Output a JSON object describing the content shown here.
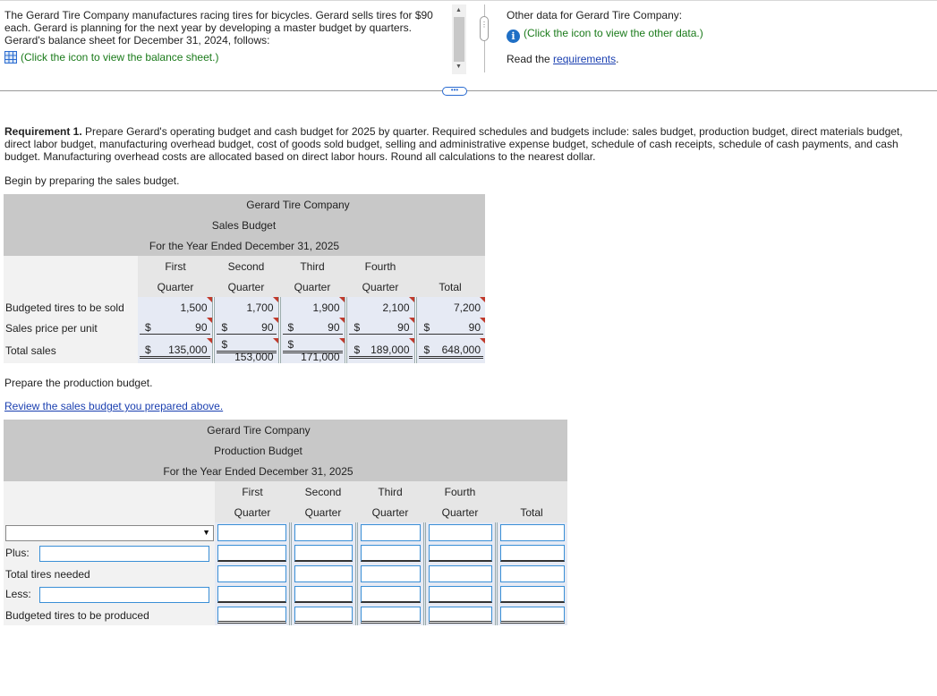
{
  "intro": {
    "text": "The Gerard Tire Company manufactures racing tires for bicycles. Gerard sells tires for $90 each. Gerard is planning for the next year by developing a master budget by quarters. Gerard's balance sheet for December 31, 2024, follows:",
    "balance_link": "(Click the icon to view the balance sheet.)"
  },
  "right": {
    "other_data": "Other data for Gerard Tire Company:",
    "other_link": "(Click the icon to view the other data.)",
    "read_prefix": "Read the",
    "req_link": "requirements",
    "read_suffix": "."
  },
  "requirement": {
    "bold": "Requirement 1.",
    "text": " Prepare Gerard's operating budget and cash budget for 2025 by quarter. Required schedules and budgets include: sales budget, production budget, direct materials budget, direct labor budget, manufacturing overhead budget, cost of goods sold budget, selling and administrative expense budget, schedule of cash receipts, schedule of cash payments, and cash budget. Manufacturing overhead costs are allocated based on direct labor hours. Round all calculations to the nearest dollar."
  },
  "begin_text": "Begin by preparing the sales budget.",
  "sales": {
    "company": "Gerard Tire Company",
    "title": "Sales Budget",
    "period": "For the Year Ended December 31, 2025",
    "col_top": [
      "First",
      "Second",
      "Third",
      "Fourth",
      ""
    ],
    "col_bottom": [
      "Quarter",
      "Quarter",
      "Quarter",
      "Quarter",
      "Total"
    ],
    "rows": [
      {
        "label": "Budgeted tires to be sold",
        "dollar": false,
        "values": [
          "1,500",
          "1,700",
          "1,900",
          "2,100",
          "7,200"
        ]
      },
      {
        "label": "Sales price per unit",
        "dollar": true,
        "values": [
          "90",
          "90",
          "90",
          "90",
          "90"
        ]
      },
      {
        "label": "Total sales",
        "dollar": true,
        "values": [
          "135,000",
          "153,000",
          "171,000",
          "189,000",
          "648,000"
        ]
      }
    ],
    "currency": "$"
  },
  "prep_prod": "Prepare the production budget.",
  "review_link": "Review the sales budget you prepared above.",
  "production": {
    "company": "Gerard Tire Company",
    "title": "Production Budget",
    "period": "For the Year Ended December 31, 2025",
    "col_top": [
      "First",
      "Second",
      "Third",
      "Fourth",
      ""
    ],
    "col_bottom": [
      "Quarter",
      "Quarter",
      "Quarter",
      "Quarter",
      "Total"
    ],
    "rows": [
      {
        "label": ""
      },
      {
        "label": "Plus:"
      },
      {
        "label": "Total tires needed"
      },
      {
        "label": "Less:"
      },
      {
        "label": "Budgeted tires to be produced"
      }
    ]
  }
}
